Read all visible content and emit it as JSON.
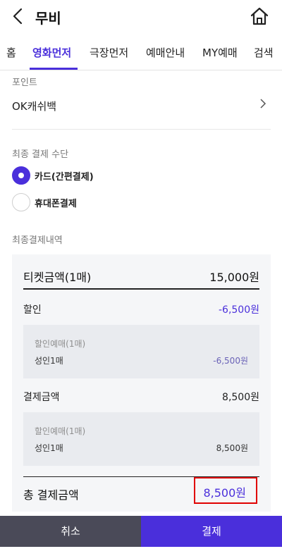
{
  "header": {
    "title": "무비"
  },
  "tabs": [
    {
      "label": "홈"
    },
    {
      "label": "영화먼저"
    },
    {
      "label": "극장먼저"
    },
    {
      "label": "예매안내"
    },
    {
      "label": "MY예매"
    },
    {
      "label": "검색"
    }
  ],
  "active_tab": "영화먼저",
  "point": {
    "section_label": "포인트",
    "item_label": "OK캐쉬백"
  },
  "payment_method": {
    "section_label": "최종 결제 수단",
    "options": [
      {
        "label": "카드(간편결제)",
        "selected": true
      },
      {
        "label": "휴대폰결제",
        "selected": false
      }
    ]
  },
  "summary": {
    "section_label": "최종결제내역",
    "ticket_label": "티켓금액(1매)",
    "ticket_value": "15,000원",
    "discount_label": "할인",
    "discount_value": "-6,500원",
    "discount_detail": {
      "title": "할인예매(1매)",
      "name": "성인1매",
      "value": "-6,500원"
    },
    "payment_label": "결제금액",
    "payment_value": "8,500원",
    "payment_detail": {
      "title": "할인예매(1매)",
      "name": "성인1매",
      "value": "8,500원"
    },
    "total_label": "총 결제금액",
    "total_value": "8,500원"
  },
  "buttons": {
    "cancel": "취소",
    "pay": "결제"
  },
  "colors": {
    "accent": "#4a2fdb",
    "cancel_bg": "#4a4a58",
    "highlight_border": "#e00000"
  },
  "icons": {
    "back": "chevron-left-icon",
    "home": "home-icon",
    "next": "chevron-right-icon"
  }
}
